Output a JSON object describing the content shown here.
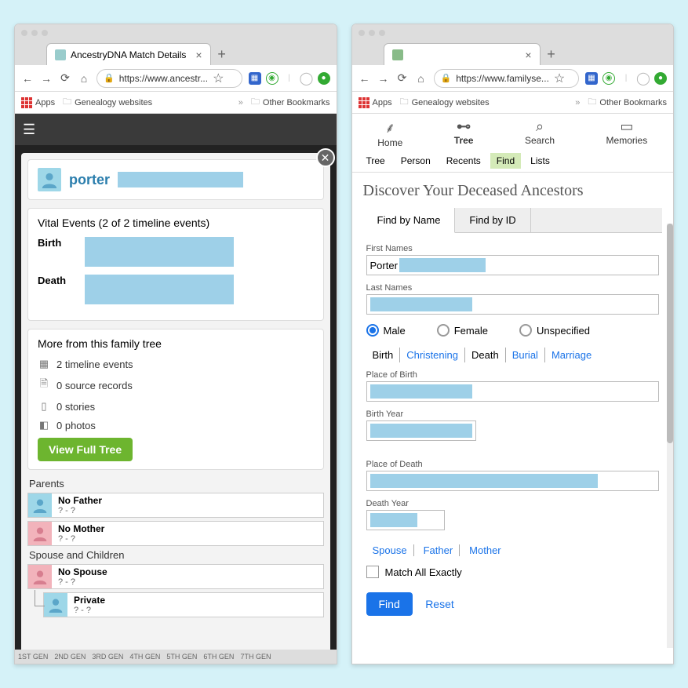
{
  "left": {
    "tab_title": "AncestryDNA Match Details",
    "url": "https://www.ancestr...",
    "bookmarks": {
      "apps": "Apps",
      "genealogy": "Genealogy websites",
      "other": "Other Bookmarks"
    },
    "person_name": "porter",
    "vital": {
      "header": "Vital Events (2 of 2 timeline events)",
      "birth_label": "Birth",
      "death_label": "Death"
    },
    "more": {
      "header": "More from this family tree",
      "timeline": "2 timeline events",
      "sources": "0 source records",
      "stories": "0 stories",
      "photos": "0 photos",
      "button": "View Full Tree"
    },
    "parents_header": "Parents",
    "no_father": "No Father",
    "no_mother": "No Mother",
    "spouse_header": "Spouse and Children",
    "no_spouse": "No Spouse",
    "private": "Private",
    "dates_unknown": "? - ?",
    "gens": [
      "1ST GEN",
      "2ND GEN",
      "3RD GEN",
      "4TH GEN",
      "5TH GEN",
      "6TH GEN",
      "7TH GEN"
    ]
  },
  "right": {
    "url": "https://www.familyse...",
    "bookmarks": {
      "apps": "Apps",
      "genealogy": "Genealogy websites",
      "other": "Other Bookmarks"
    },
    "topnav": {
      "home": "Home",
      "tree": "Tree",
      "search": "Search",
      "memories": "Memories"
    },
    "subnav": {
      "tree": "Tree",
      "person": "Person",
      "recents": "Recents",
      "find": "Find",
      "lists": "Lists"
    },
    "page_title": "Discover Your Deceased Ancestors",
    "tabs": {
      "byname": "Find by Name",
      "byid": "Find by ID"
    },
    "labels": {
      "first": "First Names",
      "last": "Last Names",
      "male": "Male",
      "female": "Female",
      "unspec": "Unspecified",
      "birth": "Birth",
      "christening": "Christening",
      "death": "Death",
      "burial": "Burial",
      "marriage": "Marriage",
      "pob": "Place of Birth",
      "by": "Birth Year",
      "pod": "Place of Death",
      "dy": "Death Year",
      "spouse": "Spouse",
      "father": "Father",
      "mother": "Mother",
      "match_all": "Match All Exactly",
      "find": "Find",
      "reset": "Reset"
    },
    "first_value": "Porter"
  }
}
